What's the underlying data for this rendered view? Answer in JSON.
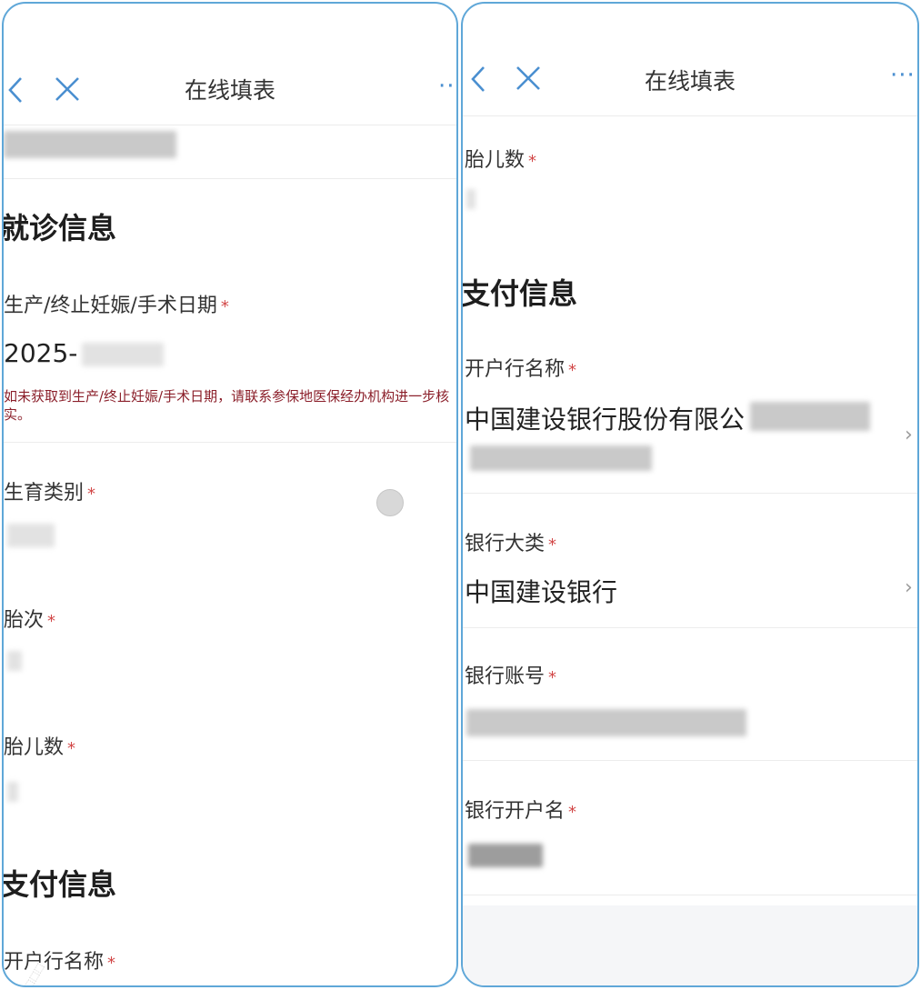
{
  "left": {
    "nav": {
      "title": "在线填表",
      "more": "···"
    },
    "sections": {
      "visit": "就诊信息",
      "payment": "支付信息"
    },
    "fields": {
      "date_label": "生产/终止妊娠/手术日期",
      "date_value": "2025-",
      "date_hint": "如未获取到生产/终止妊娠/手术日期，请联系参保地医保经办机构进一步核实。",
      "type_label": "生育类别",
      "order_label": "胎次",
      "count_label": "胎儿数",
      "bank_name_label": "开户行名称"
    },
    "required_mark": "*"
  },
  "right": {
    "nav": {
      "title": "在线填表",
      "more": "···"
    },
    "sections": {
      "payment": "支付信息"
    },
    "fields": {
      "count_label": "胎儿数",
      "bank_name_label": "开户行名称",
      "bank_name_value": "中国建设银行股份有限公",
      "bank_category_label": "银行大类",
      "bank_category_value": "中国建设银行",
      "account_label": "银行账号",
      "holder_label": "银行开户名"
    },
    "required_mark": "*"
  },
  "icons": [
    "back-icon",
    "close-icon",
    "more-icon",
    "chevron-right-icon"
  ],
  "colors": {
    "accent": "#4a8fd0",
    "required": "#d24747",
    "hint": "#8b1f2a",
    "frame": "#5fa7d8"
  }
}
